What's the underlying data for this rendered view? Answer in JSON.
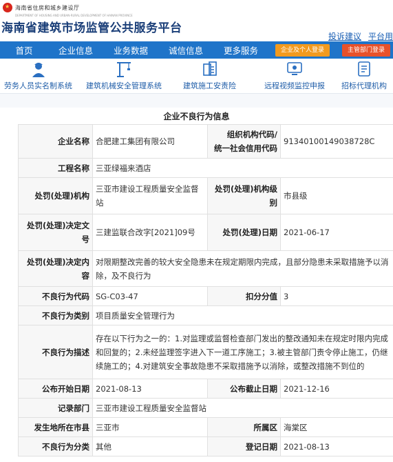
{
  "header": {
    "dept_name": "海南省住房和城乡建设厅",
    "dept_en": "DEPARTMENT OF HOUSING AND URBAN-RURAL DEVELOPMENT OF HAINAN PROVINCE",
    "site_title": "海南省建筑市场监管公共服务平台",
    "links": [
      "投诉建议",
      "平台用"
    ]
  },
  "nav": {
    "items": [
      "首页",
      "企业信息",
      "业务数据",
      "诚信信息",
      "更多服务"
    ],
    "enterprise_login": "企业及个人登录",
    "dept_login": "主管部门登录"
  },
  "services": [
    {
      "label": "劳务人员实名制系统",
      "icon": "worker-icon"
    },
    {
      "label": "建筑机械安全管理系统",
      "icon": "crane-icon"
    },
    {
      "label": "建筑施工安责险",
      "icon": "insurance-icon"
    },
    {
      "label": "远程视频监控申报",
      "icon": "video-monitor-icon"
    },
    {
      "label": "招标代理机构",
      "icon": "document-icon"
    }
  ],
  "record": {
    "section_title": "企业不良行为信息",
    "enterprise_name_label": "企业名称",
    "enterprise_name": "合肥建工集团有限公司",
    "org_code_label_1": "组织机构代码/",
    "org_code_label_2": "统一社会信用代码",
    "org_code": "91340100149038728C",
    "project_name_label": "工程名称",
    "project_name": "三亚绿福来酒店",
    "authority_label": "处罚(处理)机构",
    "authority": "三亚市建设工程质量安全监督站",
    "authority_level_label": "处罚(处理)机构级别",
    "authority_level": "市县级",
    "decision_no_label": "处罚(处理)决定文号",
    "decision_no": "三建监联合改字[2021]09号",
    "decision_date_label": "处罚(处理)日期",
    "decision_date": "2021-06-17",
    "decision_content_label": "处罚(处理)决定内容",
    "decision_content": "对限期整改完善的较大安全隐患未在规定期限内完成，且部分隐患未采取措施予以消除，及不良行为",
    "behavior_code_label": "不良行为代码",
    "behavior_code": "SG-C03-47",
    "deduction_label": "扣分分值",
    "deduction": "3",
    "behavior_category_label": "不良行为类别",
    "behavior_category": "项目质量安全管理行为",
    "behavior_desc_label": "不良行为描述",
    "behavior_desc": "存在以下行为之一的：1.对监理或监督检查部门发出的整改通知未在规定时限内完成和回复的；2.未经监理签字进入下一道工序施工；3.被主管部门责令停止施工，仍继续施工的；4.对建筑安全事故隐患不采取措施予以消除，或整改措施不到位的",
    "publish_start_label": "公布开始日期",
    "publish_start": "2021-08-13",
    "publish_end_label": "公布截止日期",
    "publish_end": "2021-12-16",
    "record_dept_label": "记录部门",
    "record_dept": "三亚市建设工程质量安全监督站",
    "city_label": "发生地所在市县",
    "city": "三亚市",
    "district_label": "所属区",
    "district": "海棠区",
    "classification_label": "不良行为分类",
    "classification": "其他",
    "register_date_label": "登记日期",
    "register_date": "2021-08-13"
  },
  "colors": {
    "nav_bg": "#1f74c9",
    "title": "#1a3e78",
    "orange_btn": "#f29a1e",
    "red_btn": "#e8512a",
    "link": "#1a5fb4"
  }
}
